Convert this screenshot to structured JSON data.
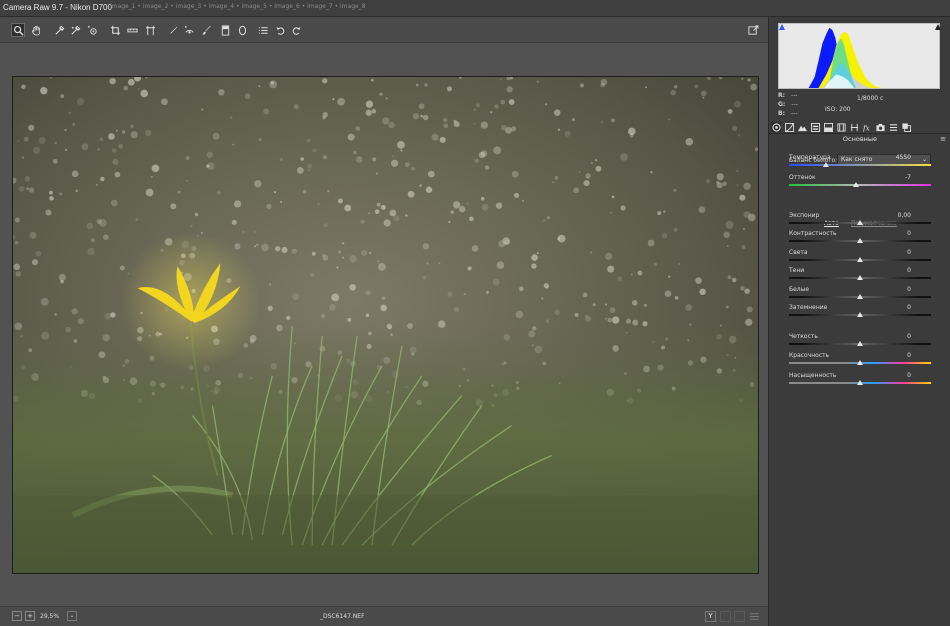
{
  "window": {
    "title": "Camera Raw 9.7  -  Nikon D700",
    "background_tabs_text": "image_1 • image_2 • image_3 • image_4 • image_5 • image_6 • image_7 • image_8"
  },
  "toolbar": {
    "tools": [
      {
        "name": "zoom-tool",
        "icon": "zoom-icon"
      },
      {
        "name": "hand-tool",
        "icon": "hand-icon"
      },
      {
        "name": "white-balance-tool",
        "icon": "eyedropper-icon"
      },
      {
        "name": "color-sampler-tool",
        "icon": "sampler-icon"
      },
      {
        "name": "targeted-adjustment-tool",
        "icon": "target-icon"
      },
      {
        "name": "crop-tool",
        "icon": "crop-icon"
      },
      {
        "name": "straighten-tool",
        "icon": "straighten-icon"
      },
      {
        "name": "transform-tool",
        "icon": "transform-icon"
      },
      {
        "name": "spot-removal-tool",
        "icon": "brush-icon"
      },
      {
        "name": "red-eye-tool",
        "icon": "eye-icon"
      },
      {
        "name": "adjustment-brush-tool",
        "icon": "paintbrush-icon"
      },
      {
        "name": "graduated-filter-tool",
        "icon": "gradient-icon"
      },
      {
        "name": "radial-filter-tool",
        "icon": "ellipse-icon"
      },
      {
        "name": "preferences-button",
        "icon": "list-icon"
      },
      {
        "name": "rotate-left-button",
        "icon": "rotate-ccw-icon"
      },
      {
        "name": "rotate-right-button",
        "icon": "rotate-cw-icon"
      }
    ],
    "fullscreen_icon": "fullscreen-icon"
  },
  "statusbar": {
    "zoom_value": "29,5%",
    "filename": "_DSC6147.NEF",
    "minus": "−",
    "plus": "+",
    "dropdown": "⌄",
    "y_button": "Y"
  },
  "histogram": {
    "r_label": "R:",
    "r_value": "---",
    "g_label": "G:",
    "g_value": "---",
    "b_label": "B:",
    "b_value": "---",
    "shutter": "1/8000 с",
    "iso": "ISO: 200"
  },
  "panel": {
    "section_title": "Основные",
    "menu_icon": "≡",
    "wb_label": "Баланс белого:",
    "wb_value": "Как снято",
    "auto_label": "Авто",
    "default_label": "По умолчанию",
    "sliders": [
      {
        "id": "temperature",
        "label": "Температура",
        "value": "4550",
        "pos": 0.26,
        "track": "temp"
      },
      {
        "id": "tint",
        "label": "Оттенок",
        "value": "-7",
        "pos": 0.47,
        "track": "tint"
      },
      {
        "id": "exposure",
        "label": "Экспонир",
        "value": "0,00",
        "pos": 0.5,
        "track": "gray"
      },
      {
        "id": "contrast",
        "label": "Контрастность",
        "value": "0",
        "pos": 0.5,
        "track": "gray"
      },
      {
        "id": "highlights",
        "label": "Света",
        "value": "0",
        "pos": 0.5,
        "track": "gray"
      },
      {
        "id": "shadows",
        "label": "Тени",
        "value": "0",
        "pos": 0.5,
        "track": "gray"
      },
      {
        "id": "whites",
        "label": "Белые",
        "value": "0",
        "pos": 0.5,
        "track": "gray"
      },
      {
        "id": "blacks",
        "label": "Затемнение",
        "value": "0",
        "pos": 0.5,
        "track": "gray"
      },
      {
        "id": "clarity",
        "label": "Четкость",
        "value": "0",
        "pos": 0.5,
        "track": "gray"
      },
      {
        "id": "vibrance",
        "label": "Красочность",
        "value": "0",
        "pos": 0.5,
        "track": "spectrum"
      },
      {
        "id": "saturation",
        "label": "Насыщенность",
        "value": "0",
        "pos": 0.5,
        "track": "spectrum"
      }
    ]
  },
  "colors": {
    "accent": "#f0d020",
    "histogram_blue": "#0a1cff",
    "histogram_yellow": "#f6f200"
  }
}
